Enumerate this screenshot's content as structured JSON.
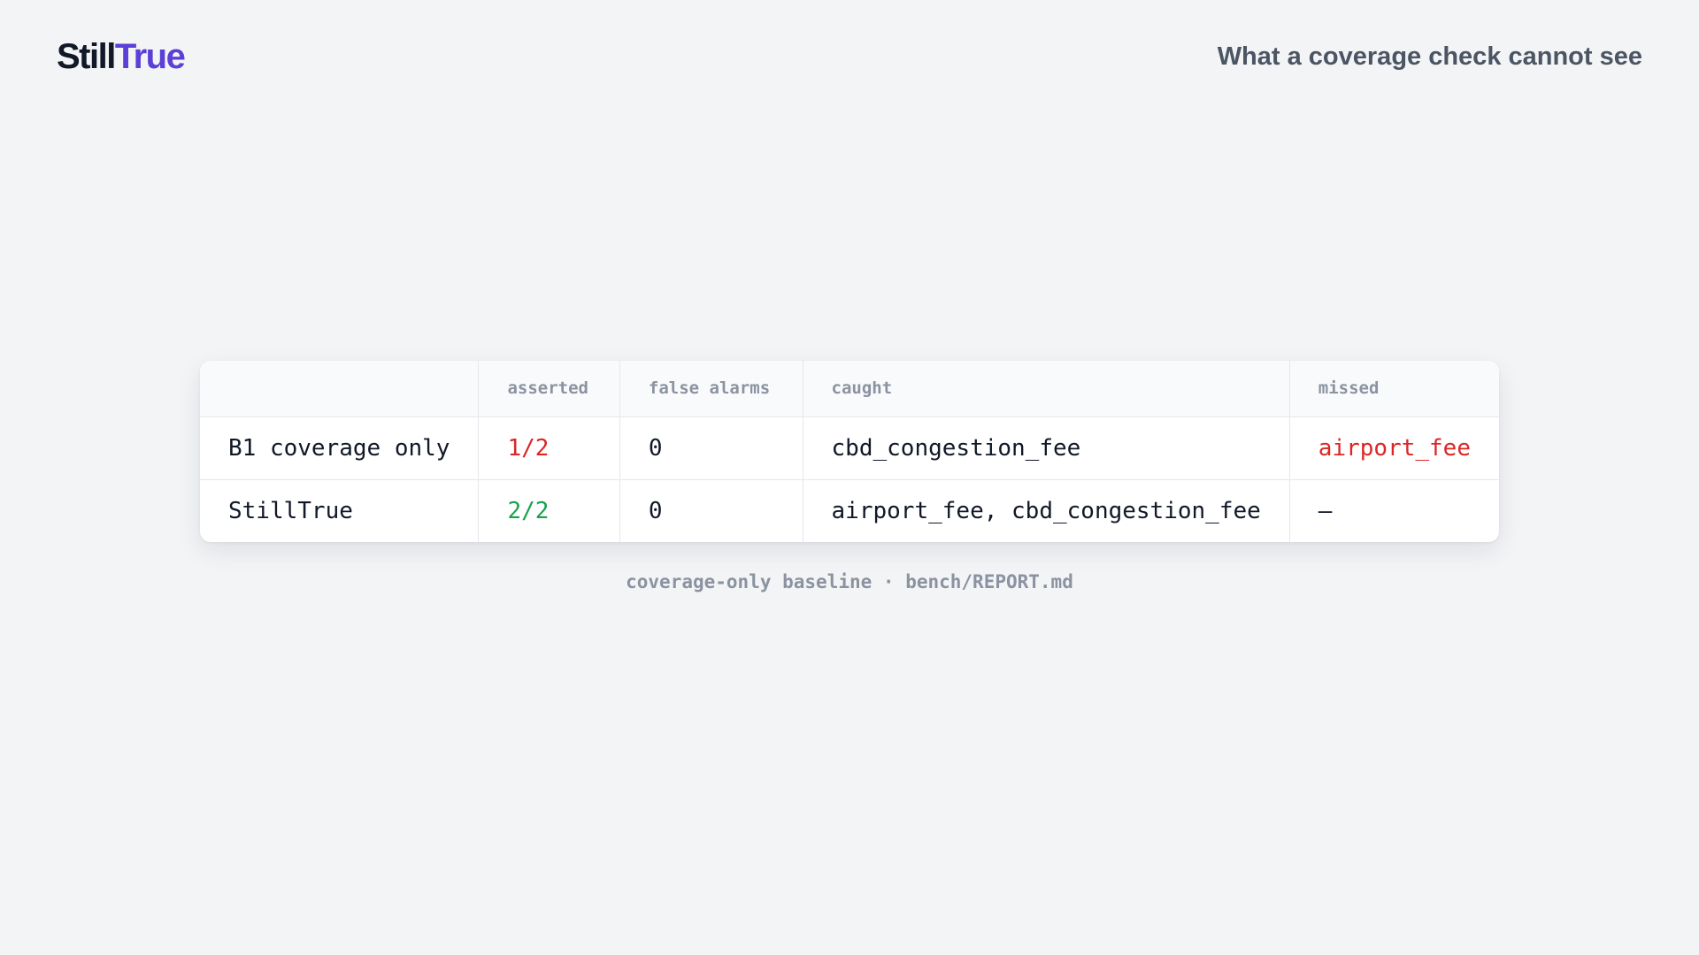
{
  "header": {
    "logo_part1": "Still",
    "logo_part2": "True",
    "subtitle": "What a coverage check cannot see"
  },
  "colors": {
    "brand_dark": "#111827",
    "brand_accent": "#5b3fd6",
    "bad": "#dc2626",
    "good": "#16a34a"
  },
  "table": {
    "headers": [
      "",
      "asserted",
      "false alarms",
      "caught",
      "missed"
    ],
    "rows": [
      {
        "label": "B1 coverage only",
        "asserted": "1/2",
        "false_alarms": "0",
        "caught": "cbd_congestion_fee",
        "missed": "airport_fee"
      },
      {
        "label": "StillTrue",
        "asserted": "2/2",
        "false_alarms": "0",
        "caught": "airport_fee, cbd_congestion_fee",
        "missed": "—"
      }
    ]
  },
  "caption": "coverage-only baseline · bench/REPORT.md"
}
